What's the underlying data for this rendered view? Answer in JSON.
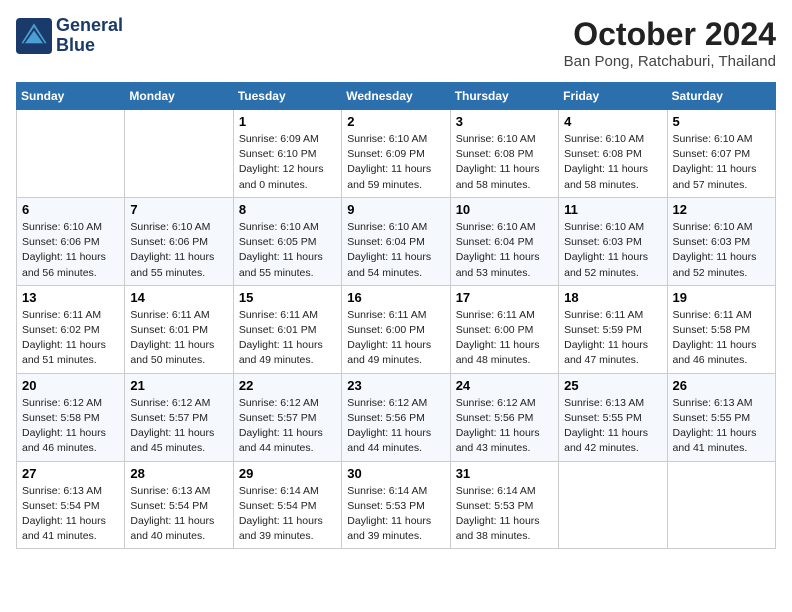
{
  "header": {
    "logo_line1": "General",
    "logo_line2": "Blue",
    "month": "October 2024",
    "location": "Ban Pong, Ratchaburi, Thailand"
  },
  "days_of_week": [
    "Sunday",
    "Monday",
    "Tuesday",
    "Wednesday",
    "Thursday",
    "Friday",
    "Saturday"
  ],
  "weeks": [
    [
      {
        "day": "",
        "content": ""
      },
      {
        "day": "",
        "content": ""
      },
      {
        "day": "1",
        "content": "Sunrise: 6:09 AM\nSunset: 6:10 PM\nDaylight: 12 hours\nand 0 minutes."
      },
      {
        "day": "2",
        "content": "Sunrise: 6:10 AM\nSunset: 6:09 PM\nDaylight: 11 hours\nand 59 minutes."
      },
      {
        "day": "3",
        "content": "Sunrise: 6:10 AM\nSunset: 6:08 PM\nDaylight: 11 hours\nand 58 minutes."
      },
      {
        "day": "4",
        "content": "Sunrise: 6:10 AM\nSunset: 6:08 PM\nDaylight: 11 hours\nand 58 minutes."
      },
      {
        "day": "5",
        "content": "Sunrise: 6:10 AM\nSunset: 6:07 PM\nDaylight: 11 hours\nand 57 minutes."
      }
    ],
    [
      {
        "day": "6",
        "content": "Sunrise: 6:10 AM\nSunset: 6:06 PM\nDaylight: 11 hours\nand 56 minutes."
      },
      {
        "day": "7",
        "content": "Sunrise: 6:10 AM\nSunset: 6:06 PM\nDaylight: 11 hours\nand 55 minutes."
      },
      {
        "day": "8",
        "content": "Sunrise: 6:10 AM\nSunset: 6:05 PM\nDaylight: 11 hours\nand 55 minutes."
      },
      {
        "day": "9",
        "content": "Sunrise: 6:10 AM\nSunset: 6:04 PM\nDaylight: 11 hours\nand 54 minutes."
      },
      {
        "day": "10",
        "content": "Sunrise: 6:10 AM\nSunset: 6:04 PM\nDaylight: 11 hours\nand 53 minutes."
      },
      {
        "day": "11",
        "content": "Sunrise: 6:10 AM\nSunset: 6:03 PM\nDaylight: 11 hours\nand 52 minutes."
      },
      {
        "day": "12",
        "content": "Sunrise: 6:10 AM\nSunset: 6:03 PM\nDaylight: 11 hours\nand 52 minutes."
      }
    ],
    [
      {
        "day": "13",
        "content": "Sunrise: 6:11 AM\nSunset: 6:02 PM\nDaylight: 11 hours\nand 51 minutes."
      },
      {
        "day": "14",
        "content": "Sunrise: 6:11 AM\nSunset: 6:01 PM\nDaylight: 11 hours\nand 50 minutes."
      },
      {
        "day": "15",
        "content": "Sunrise: 6:11 AM\nSunset: 6:01 PM\nDaylight: 11 hours\nand 49 minutes."
      },
      {
        "day": "16",
        "content": "Sunrise: 6:11 AM\nSunset: 6:00 PM\nDaylight: 11 hours\nand 49 minutes."
      },
      {
        "day": "17",
        "content": "Sunrise: 6:11 AM\nSunset: 6:00 PM\nDaylight: 11 hours\nand 48 minutes."
      },
      {
        "day": "18",
        "content": "Sunrise: 6:11 AM\nSunset: 5:59 PM\nDaylight: 11 hours\nand 47 minutes."
      },
      {
        "day": "19",
        "content": "Sunrise: 6:11 AM\nSunset: 5:58 PM\nDaylight: 11 hours\nand 46 minutes."
      }
    ],
    [
      {
        "day": "20",
        "content": "Sunrise: 6:12 AM\nSunset: 5:58 PM\nDaylight: 11 hours\nand 46 minutes."
      },
      {
        "day": "21",
        "content": "Sunrise: 6:12 AM\nSunset: 5:57 PM\nDaylight: 11 hours\nand 45 minutes."
      },
      {
        "day": "22",
        "content": "Sunrise: 6:12 AM\nSunset: 5:57 PM\nDaylight: 11 hours\nand 44 minutes."
      },
      {
        "day": "23",
        "content": "Sunrise: 6:12 AM\nSunset: 5:56 PM\nDaylight: 11 hours\nand 44 minutes."
      },
      {
        "day": "24",
        "content": "Sunrise: 6:12 AM\nSunset: 5:56 PM\nDaylight: 11 hours\nand 43 minutes."
      },
      {
        "day": "25",
        "content": "Sunrise: 6:13 AM\nSunset: 5:55 PM\nDaylight: 11 hours\nand 42 minutes."
      },
      {
        "day": "26",
        "content": "Sunrise: 6:13 AM\nSunset: 5:55 PM\nDaylight: 11 hours\nand 41 minutes."
      }
    ],
    [
      {
        "day": "27",
        "content": "Sunrise: 6:13 AM\nSunset: 5:54 PM\nDaylight: 11 hours\nand 41 minutes."
      },
      {
        "day": "28",
        "content": "Sunrise: 6:13 AM\nSunset: 5:54 PM\nDaylight: 11 hours\nand 40 minutes."
      },
      {
        "day": "29",
        "content": "Sunrise: 6:14 AM\nSunset: 5:54 PM\nDaylight: 11 hours\nand 39 minutes."
      },
      {
        "day": "30",
        "content": "Sunrise: 6:14 AM\nSunset: 5:53 PM\nDaylight: 11 hours\nand 39 minutes."
      },
      {
        "day": "31",
        "content": "Sunrise: 6:14 AM\nSunset: 5:53 PM\nDaylight: 11 hours\nand 38 minutes."
      },
      {
        "day": "",
        "content": ""
      },
      {
        "day": "",
        "content": ""
      }
    ]
  ]
}
